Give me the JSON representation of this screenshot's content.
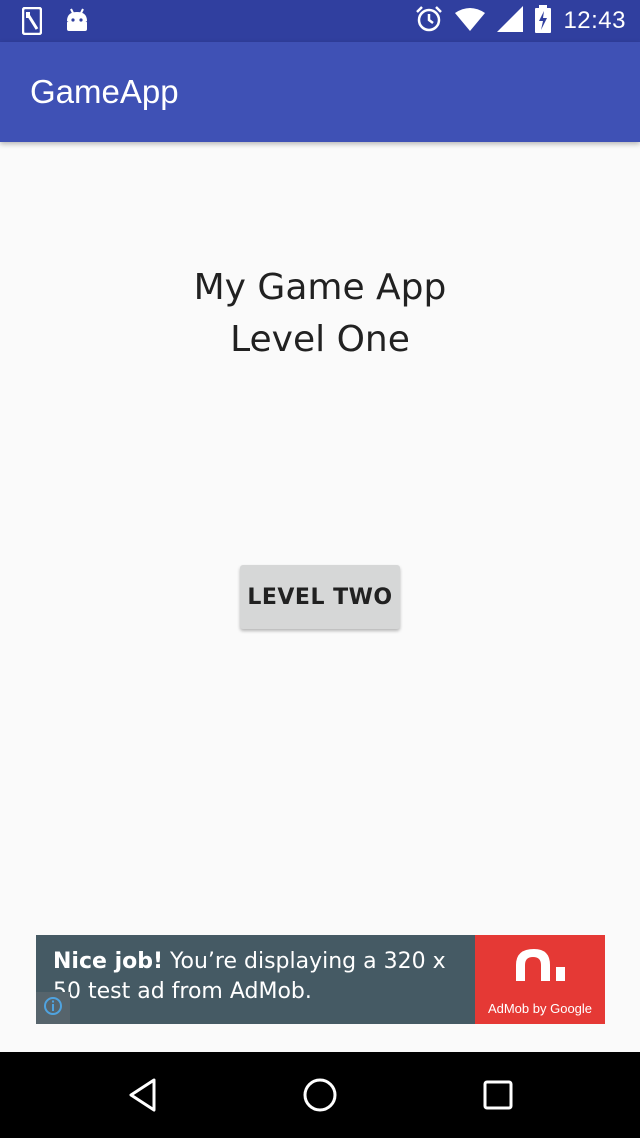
{
  "status_bar": {
    "time": "12:43",
    "icons": [
      "sim-card-icon",
      "android-icon",
      "alarm-icon",
      "wifi-icon",
      "signal-icon",
      "battery-charging-icon"
    ]
  },
  "app_bar": {
    "title": "GameApp"
  },
  "main": {
    "heading_line1": "My Game App",
    "heading_line2": "Level One",
    "level_button_label": "LEVEL TWO"
  },
  "ad": {
    "bold_text": "Nice job!",
    "body_text": " You’re displaying a 320 x 50 test ad from AdMob.",
    "brand_caption": "AdMob by Google",
    "info_icon": "info-icon"
  },
  "navigation": {
    "buttons": [
      "back-icon",
      "home-icon",
      "recents-icon"
    ]
  },
  "colors": {
    "status_bar": "#303f9f",
    "app_bar": "#3f51b5",
    "background": "#fafafa",
    "button": "#d6d7d7",
    "ad_background": "#455a64",
    "ad_logo": "#e53935"
  }
}
